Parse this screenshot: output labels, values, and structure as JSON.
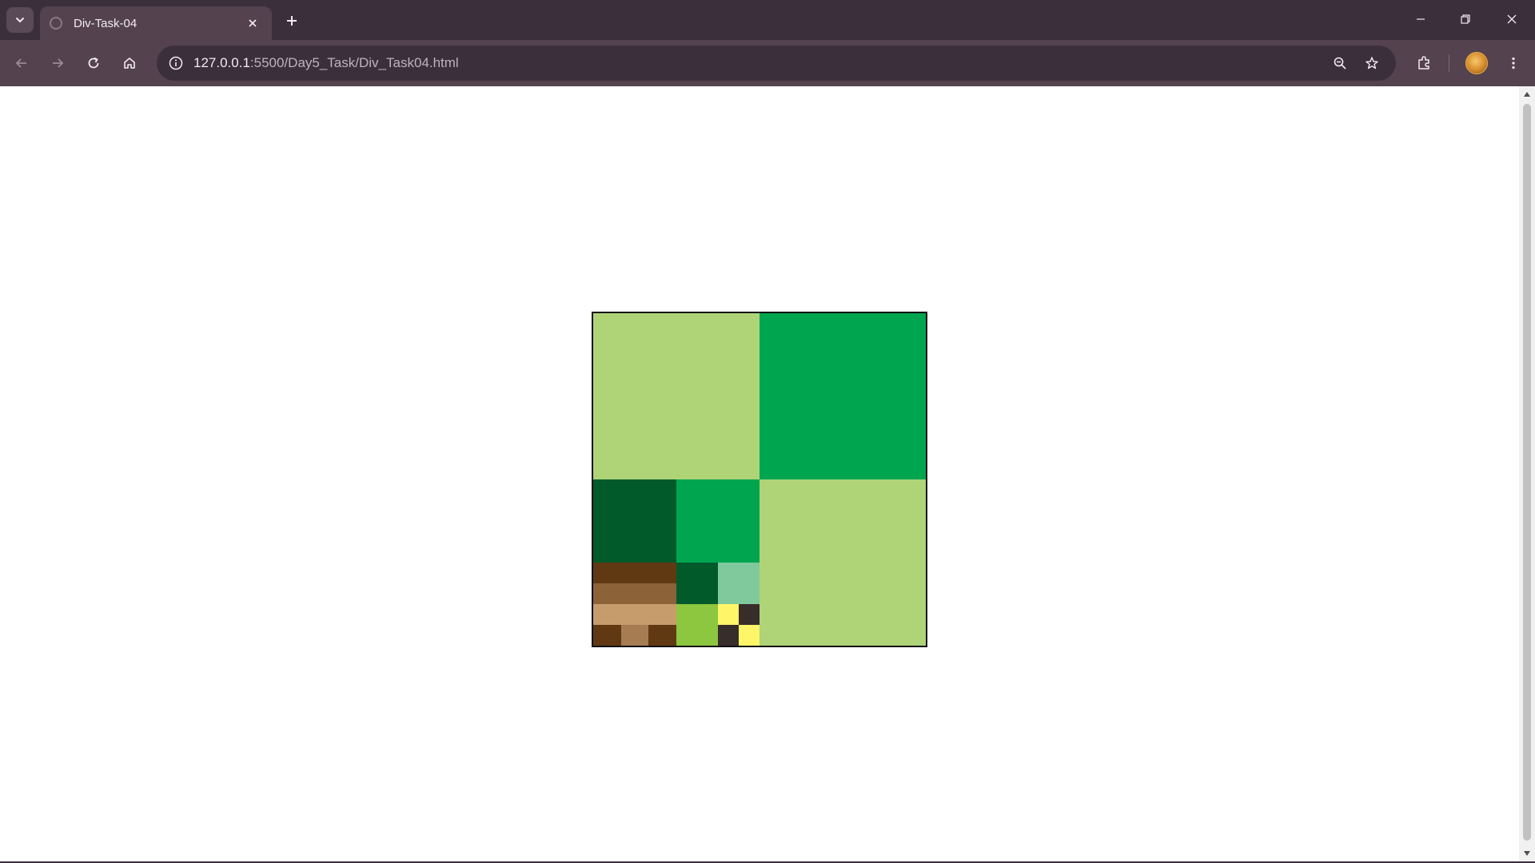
{
  "browser": {
    "tab_title": "Div-Task-04",
    "url_host": "127.0.0.1",
    "url_path": ":5500/Day5_Task/Div_Task04.html"
  },
  "artwork": {
    "colors": {
      "light_green": "#aed477",
      "green": "#00a550",
      "dark_green": "#005a2a",
      "mint": "#80c99c",
      "lime": "#8dc63f",
      "yellow": "#fff568",
      "dark_gray": "#372d2b",
      "brown_dark": "#603913",
      "brown_mid": "#8c6239",
      "tan": "#c69c6d",
      "brown_light": "#a67c52",
      "border": "#111111"
    }
  }
}
